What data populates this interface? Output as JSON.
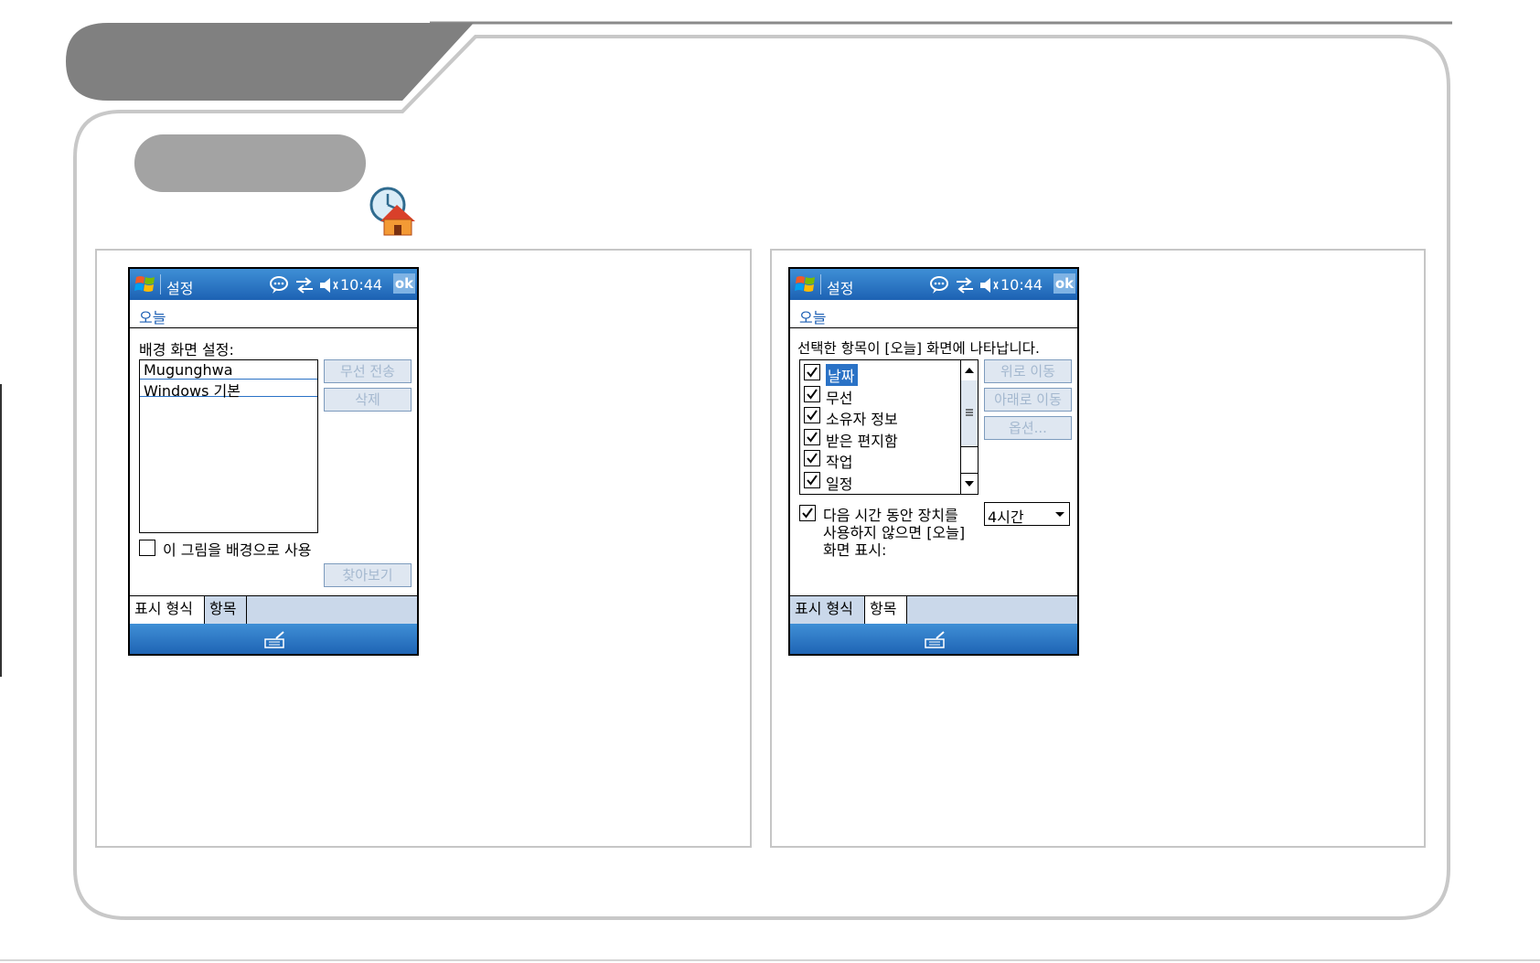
{
  "left_screen": {
    "titlebar": {
      "title": "설정",
      "time": "10:44",
      "ok": "ok"
    },
    "page_heading": "오늘",
    "background_label": "배경 화면 설정:",
    "themes": [
      "Mugunghwa",
      "Windows 기본"
    ],
    "beam_button": "무선 전송",
    "delete_button": "삭제",
    "use_picture_label": "이 그림을 배경으로 사용",
    "browse_button": "찾아보기",
    "tabs": [
      "표시 형식",
      "항목"
    ],
    "active_tab": "표시 형식"
  },
  "right_screen": {
    "titlebar": {
      "title": "설정",
      "time": "10:44",
      "ok": "ok"
    },
    "page_heading": "오늘",
    "instruction": "선택한 항목이 [오늘] 화면에 나타납니다.",
    "items": [
      {
        "label": "날짜",
        "checked": true,
        "selected": true
      },
      {
        "label": "무선",
        "checked": true,
        "selected": false
      },
      {
        "label": "소유자 정보",
        "checked": true,
        "selected": false
      },
      {
        "label": "받은 편지함",
        "checked": true,
        "selected": false
      },
      {
        "label": "작업",
        "checked": true,
        "selected": false
      },
      {
        "label": "일정",
        "checked": true,
        "selected": false
      }
    ],
    "move_up_button": "위로 이동",
    "move_down_button": "아래로 이동",
    "options_button": "옵션...",
    "timeout_line1": "다음 시간 동안 장치를",
    "timeout_line2": "사용하지 않으면 [오늘]",
    "timeout_line3": "화면 표시:",
    "timeout_value": "4시간",
    "tabs": [
      "표시 형식",
      "항목"
    ],
    "active_tab": "항목"
  },
  "colors": {
    "titlebar": "#1d62b3",
    "selection": "#2a72c6",
    "tabbar": "#cad8ea",
    "slide_header": "#808080"
  }
}
